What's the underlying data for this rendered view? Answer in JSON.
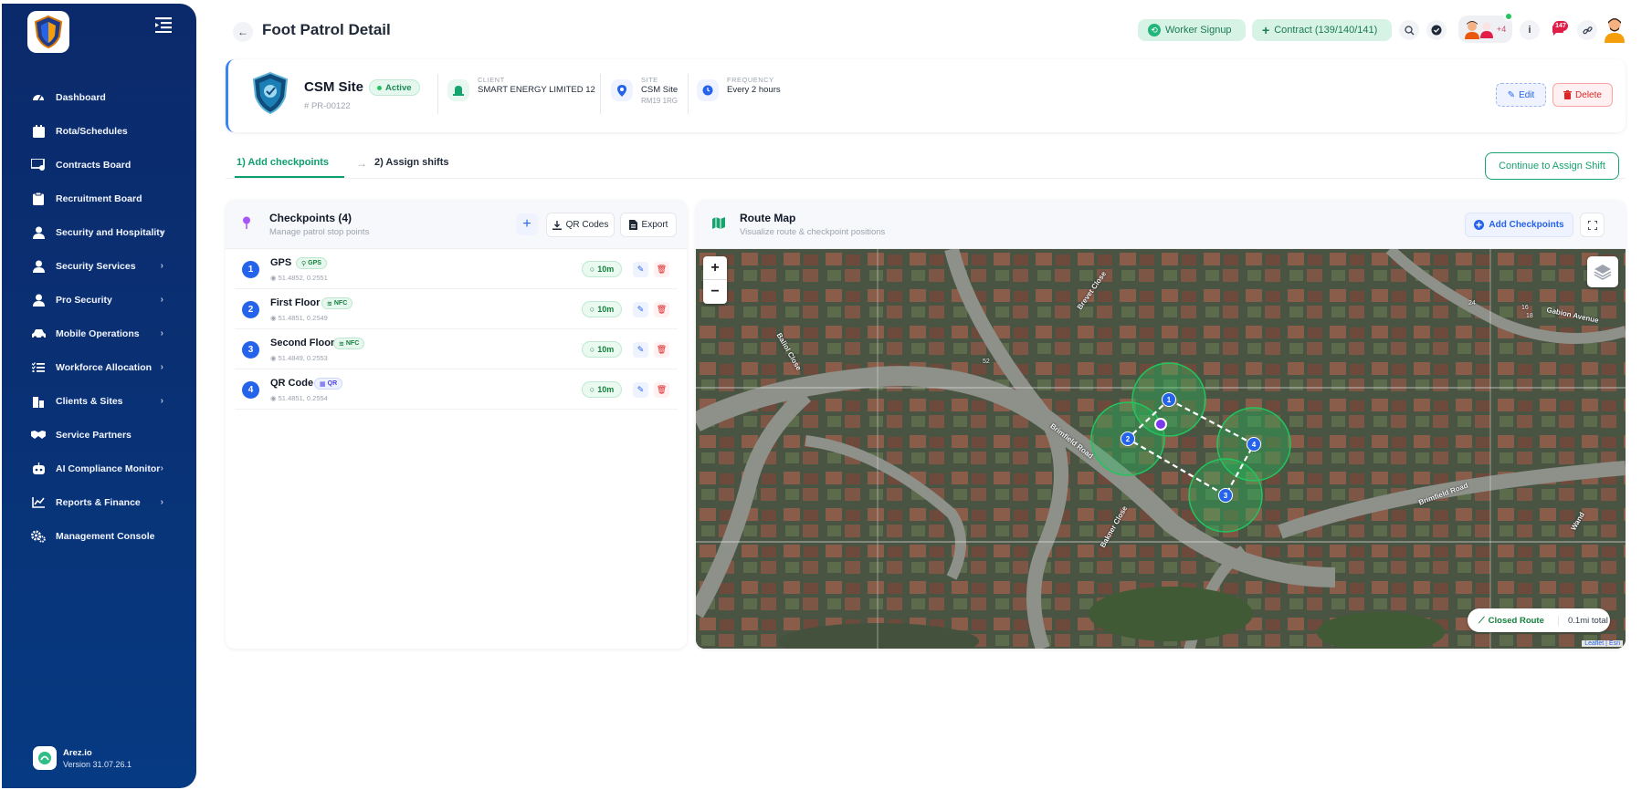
{
  "sidebar": {
    "items": [
      {
        "label": "Dashboard",
        "icon": "dashboard-icon",
        "chevron": false
      },
      {
        "label": "Rota/Schedules",
        "icon": "calendar-icon",
        "chevron": false
      },
      {
        "label": "Contracts Board",
        "icon": "contracts-icon",
        "chevron": false
      },
      {
        "label": "Recruitment Board",
        "icon": "clipboard-icon",
        "chevron": false
      },
      {
        "label": "Security and Hospitality",
        "icon": "user-icon",
        "chevron": true
      },
      {
        "label": "Security Services",
        "icon": "user-icon",
        "chevron": true
      },
      {
        "label": "Pro Security",
        "icon": "user-icon",
        "chevron": true
      },
      {
        "label": "Mobile Operations",
        "icon": "car-icon",
        "chevron": true
      },
      {
        "label": "Workforce Allocation",
        "icon": "list-check-icon",
        "chevron": true
      },
      {
        "label": "Clients & Sites",
        "icon": "building-icon",
        "chevron": true
      },
      {
        "label": "Service Partners",
        "icon": "handshake-icon",
        "chevron": false
      },
      {
        "label": "AI Compliance Monitor",
        "icon": "robot-icon",
        "chevron": true
      },
      {
        "label": "Reports & Finance",
        "icon": "chart-line-icon",
        "chevron": true
      },
      {
        "label": "Management Console",
        "icon": "gears-icon",
        "chevron": false
      }
    ],
    "footer": {
      "name": "Arez.io",
      "version": "Version 31.07.26.1"
    }
  },
  "header": {
    "title": "Foot Patrol Detail",
    "worker_signup": "Worker Signup",
    "contract": "Contract (139/140/141)",
    "avatars_more": "+4",
    "notifications_count": "147"
  },
  "site": {
    "name": "CSM Site",
    "status": "Active",
    "code": "PR-00122",
    "client_label": "CLIENT",
    "client_value": "SMART ENERGY LIMITED 12",
    "site_label": "SITE",
    "site_value": "CSM Site",
    "site_postcode": "RM19 1RG",
    "frequency_label": "FREQUENCY",
    "frequency_value": "Every 2 hours",
    "edit_label": "Edit",
    "delete_label": "Delete"
  },
  "steps": {
    "step1": "1) Add checkpoints",
    "step2": "2) Assign shifts",
    "continue": "Continue to Assign Shift"
  },
  "checkpoints": {
    "title": "Checkpoints (4)",
    "subtitle": "Manage patrol stop points",
    "qr_codes": "QR Codes",
    "export": "Export",
    "items": [
      {
        "num": "1",
        "name": "GPS",
        "type": "GPS",
        "type_class": "gps",
        "coords": "51.4852, 0.2551",
        "time": "10m"
      },
      {
        "num": "2",
        "name": "First Floor",
        "type": "NFC",
        "type_class": "nfc",
        "coords": "51.4851, 0.2549",
        "time": "10m"
      },
      {
        "num": "3",
        "name": "Second Floor",
        "type": "NFC",
        "type_class": "nfc",
        "coords": "51.4849, 0.2553",
        "time": "10m"
      },
      {
        "num": "4",
        "name": "QR Code",
        "type": "QR",
        "type_class": "qr",
        "coords": "51.4851, 0.2554",
        "time": "10m"
      }
    ]
  },
  "map": {
    "title": "Route Map",
    "subtitle": "Visualize route & checkpoint positions",
    "add_checkpoints": "Add Checkpoints",
    "route_label": "Closed Route",
    "route_total": "0.1mi total",
    "attribution": "Leaflet | Esri",
    "road_labels": [
      "Brimfield Road",
      "Brimfield Road",
      "Brevet Close",
      "Gabion Avenue",
      "Baliol Close",
      "Bakner Close",
      "Wand"
    ],
    "house_numbers": [
      "52",
      "24",
      "16",
      "18"
    ],
    "markers": [
      "1",
      "2",
      "3",
      "4"
    ]
  },
  "colors": {
    "brand_green": "#16a36e",
    "primary_blue": "#2563eb",
    "sidebar_bg": "#0b2a6b",
    "danger": "#dc2626"
  }
}
